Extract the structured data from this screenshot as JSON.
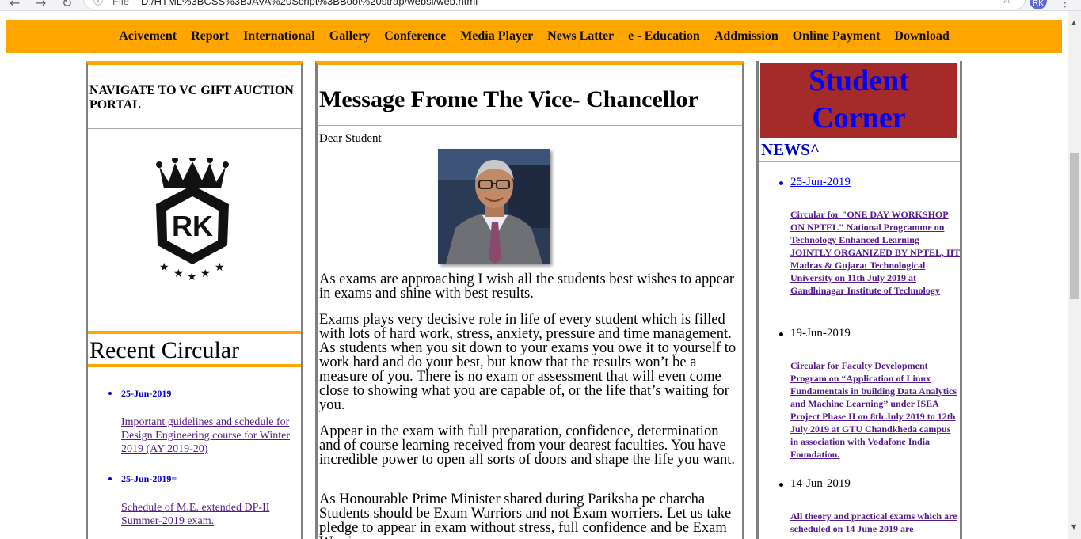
{
  "browser": {
    "back": "←",
    "forward": "→",
    "reload": "↻",
    "info": "ⓘ",
    "file_label": "File",
    "url": "D:/HTML%3BCSS%3BJAVA%20Script%3BBoot%20strap/websi/web.html",
    "star": "☆",
    "avatar_initials": "RK",
    "menu": "⋮"
  },
  "nav": [
    "Acivement",
    "Report",
    "International",
    "Gallery",
    "Conference",
    "Media Player",
    "News Latter",
    "e - Education",
    "Addmission",
    "Online Payment",
    "Download"
  ],
  "left": {
    "vc_link": "NAVIGATE TO VC GIFT AUCTION PORTAL",
    "logo_text": "RK",
    "recent_title": "Recent Circular",
    "circulars": [
      {
        "date": "25-Jun-2019",
        "text": "Important guidelines and schedule for Design Engineering course for Winter 2019 (AY 2019-20)"
      },
      {
        "date": "25-Jun-2019=",
        "text": "Schedule of M.E. extended DP-II Summer-2019 exam."
      }
    ]
  },
  "middle": {
    "title": "Message Frome The Vice- Chancellor",
    "greeting": "Dear Student",
    "paragraphs": [
      "As exams are approaching I wish all the students best wishes to appear in exams and shine with best results.",
      "Exams plays very decisive role in life of every student which is filled with lots of hard work, stress, anxiety, pressure and time management. As students when you sit down to your exams you owe it to yourself to work hard and do your best, but know that the results won’t be a measure of you. There is no exam or assessment that will even come close to showing what you are capable of, or the life that’s waiting for you.",
      "Appear in the exam with full preparation, confidence, determination and of course learning received from your dearest faculties. You have incredible power to open all sorts of doors and shape the life you want.",
      "As Honourable Prime Minister shared during Pariksha pe charcha Students should be Exam Warriors and not Exam worriers. Let us take pledge to appear in exam without stress, full confidence and be Exam Warriors."
    ]
  },
  "right": {
    "student_corner": "Student Corner",
    "news_title": "NEWS^",
    "news": [
      {
        "date": "25-Jun-2019",
        "text": "Circular for \"ONE DAY WORKSHOP ON NPTEL\" National Programme on Technology Enhanced Learning JOINTLY ORGANIZED BY NPTEL, IIT Madras & Gujarat Technological University on 11th July 2019 at Gandhinagar Institute of Technology"
      },
      {
        "date": "19-Jun-2019",
        "text": "Circular for Faculty Development Program on “Application of Linux Fundamentals in building Data Analytics and Machine Learning” under ISEA Project Phase II on 8th July 2019 to 12th July 2019 at GTU Chandkheda campus in association with Vodafone India Foundation."
      },
      {
        "date": "14-Jun-2019",
        "text": "All theory and practical exams which are scheduled on 14 June 2019 are"
      }
    ]
  },
  "colors": {
    "orange": "#ffa500",
    "student_corner_bg": "#a52a2a",
    "student_corner_text": "#0000ff",
    "link_visited": "#551a8b",
    "link_blue": "#0000cd"
  }
}
